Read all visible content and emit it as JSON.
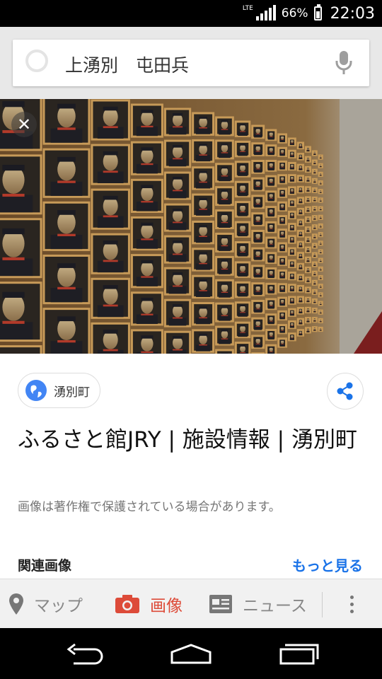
{
  "status_bar": {
    "network": "LTE",
    "battery": "66%",
    "time": "22:03"
  },
  "search": {
    "query": "上湧別　屯田兵"
  },
  "image_viewer": {
    "image_description_icon": "portrait-gallery-photo",
    "close_icon": "close-icon"
  },
  "result": {
    "source": "湧別町",
    "title": "ふるさと館JRY | 施設情報 | 湧別町",
    "copyright_notice": "画像は著作権で保護されている場合があります。",
    "related_label": "関連画像",
    "more_label": "もっと見る"
  },
  "tabs": [
    {
      "label": "マップ",
      "icon": "map-pin-icon"
    },
    {
      "label": "画像",
      "icon": "camera-icon"
    },
    {
      "label": "ニュース",
      "icon": "news-icon"
    }
  ],
  "colors": {
    "accent_red": "#dd4b39",
    "link_blue": "#1a73e8",
    "globe_blue": "#4285f4"
  }
}
